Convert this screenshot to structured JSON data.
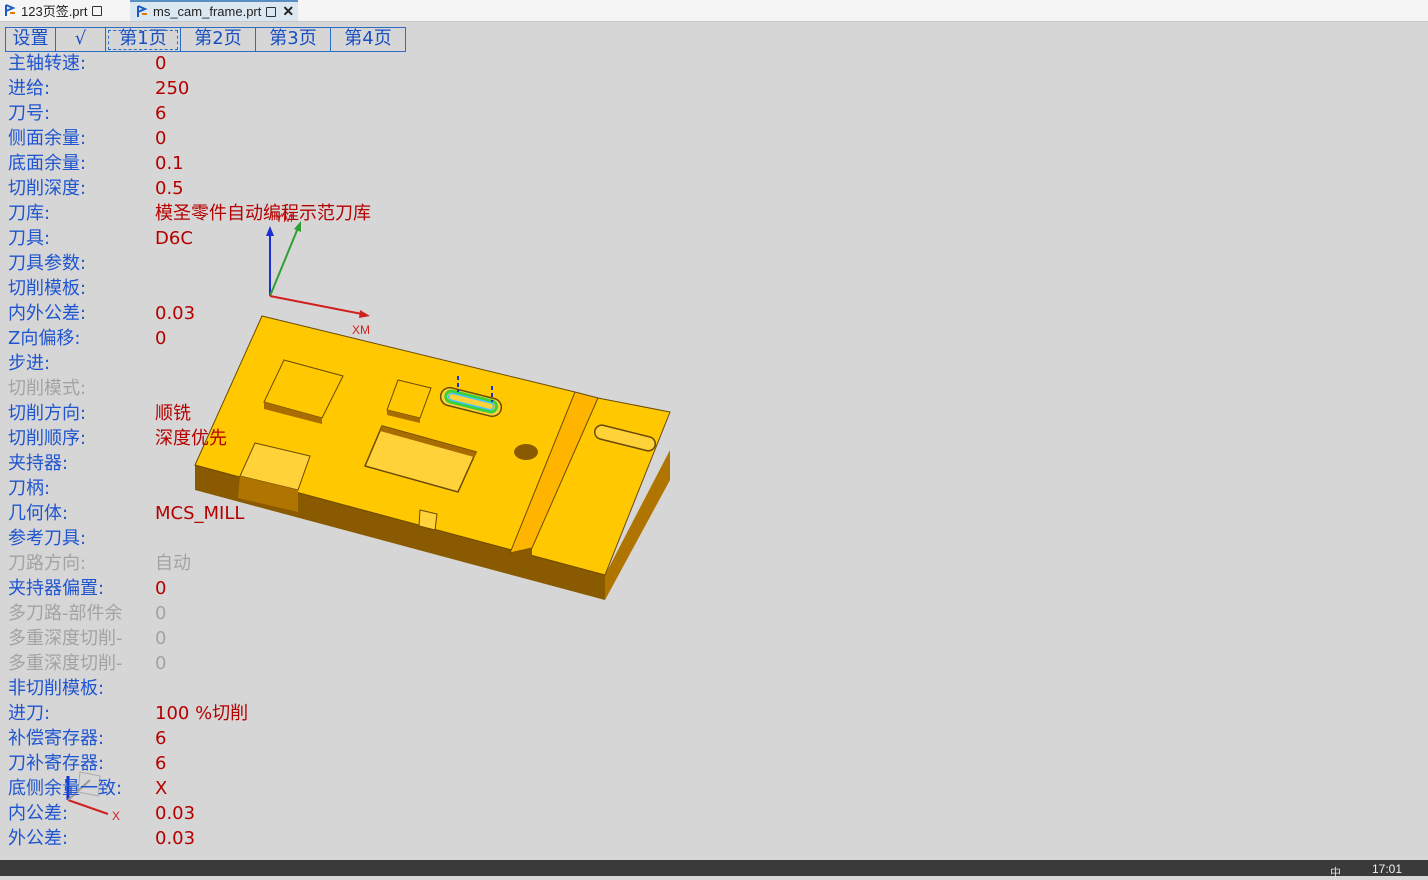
{
  "doc_tabs": [
    {
      "label": "123页签.prt",
      "active": false
    },
    {
      "label": "ms_cam_frame.prt",
      "active": true
    }
  ],
  "page_tabs": [
    {
      "label": "设置",
      "active": false
    },
    {
      "label": "√",
      "active": false
    },
    {
      "label": "第1页",
      "active": true
    },
    {
      "label": "第2页",
      "active": false
    },
    {
      "label": "第3页",
      "active": false
    },
    {
      "label": "第4页",
      "active": false
    }
  ],
  "params": [
    {
      "label": "主轴转速:",
      "value": "0",
      "disabled": false
    },
    {
      "label": "进给:",
      "value": "250",
      "disabled": false
    },
    {
      "label": "刀号:",
      "value": "6",
      "disabled": false
    },
    {
      "label": "侧面余量:",
      "value": "0",
      "disabled": false
    },
    {
      "label": "底面余量:",
      "value": "0.1",
      "disabled": false
    },
    {
      "label": "切削深度:",
      "value": "0.5",
      "disabled": false
    },
    {
      "label": "刀库:",
      "value": "模圣零件自动编程示范刀库",
      "disabled": false
    },
    {
      "label": "刀具:",
      "value": "D6C",
      "disabled": false
    },
    {
      "label": "刀具参数:",
      "value": "",
      "disabled": false
    },
    {
      "label": "切削模板:",
      "value": "",
      "disabled": false
    },
    {
      "label": "内外公差:",
      "value": "0.03",
      "disabled": false
    },
    {
      "label": "Z向偏移:",
      "value": "0",
      "disabled": false
    },
    {
      "label": "步进:",
      "value": "",
      "disabled": false
    },
    {
      "label": "切削模式:",
      "value": "",
      "disabled": true
    },
    {
      "label": "切削方向:",
      "value": "顺铣",
      "disabled": false
    },
    {
      "label": "切削顺序:",
      "value": "深度优先",
      "disabled": false
    },
    {
      "label": "夹持器:",
      "value": "",
      "disabled": false
    },
    {
      "label": "刀柄:",
      "value": "",
      "disabled": false
    },
    {
      "label": "几何体:",
      "value": "MCS_MILL",
      "disabled": false
    },
    {
      "label": "参考刀具:",
      "value": "",
      "disabled": false
    },
    {
      "label": "刀路方向:",
      "value": "自动",
      "disabled": true
    },
    {
      "label": "夹持器偏置:",
      "value": "0",
      "disabled": false
    },
    {
      "label": "多刀路-部件余",
      "value": "0",
      "disabled": true
    },
    {
      "label": "多重深度切削-",
      "value": "0",
      "disabled": true
    },
    {
      "label": "多重深度切削-",
      "value": "0",
      "disabled": true
    },
    {
      "label": "非切削模板:",
      "value": "",
      "disabled": false
    },
    {
      "label": "进刀:",
      "value": "100 %切削",
      "disabled": false
    },
    {
      "label": "补偿寄存器:",
      "value": "6",
      "disabled": false
    },
    {
      "label": "刀补寄存器:",
      "value": "6",
      "disabled": false
    },
    {
      "label": "底侧余量一致:",
      "value": "X",
      "disabled": false
    },
    {
      "label": "内公差:",
      "value": "0.03",
      "disabled": false
    },
    {
      "label": "外公差:",
      "value": "0.03",
      "disabled": false
    }
  ],
  "viewport": {
    "csys_labels": {
      "x": "XM",
      "y": "YM"
    },
    "triad_labels": {
      "x": "X"
    },
    "part_color": "#ffc800",
    "part_side_color": "#9a6400"
  },
  "taskbar": {
    "clock": "17:01",
    "ime": "中"
  }
}
